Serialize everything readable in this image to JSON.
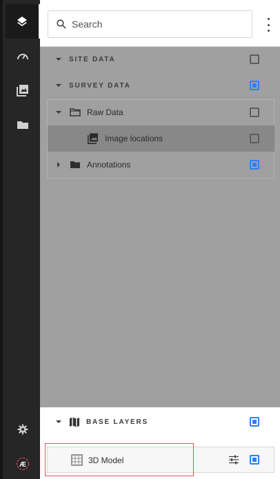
{
  "rail": {
    "items": [
      {
        "icon": "layers-icon",
        "active": true
      },
      {
        "icon": "gauge-icon",
        "active": false
      },
      {
        "icon": "image-gallery-icon",
        "active": false
      },
      {
        "icon": "folder-icon",
        "active": false
      }
    ],
    "bottom_items": [
      {
        "icon": "gear-icon"
      },
      {
        "icon": "logo-icon",
        "logo_text": "Æ"
      }
    ]
  },
  "search": {
    "placeholder": "Search",
    "value": ""
  },
  "layers": {
    "site_data": {
      "label": "SITE DATA",
      "checked": false
    },
    "survey_data": {
      "label": "SURVEY DATA",
      "checked": "partial"
    },
    "raw_data": {
      "label": "Raw Data",
      "checked": false
    },
    "image_locations": {
      "label": "Image locations",
      "checked": false
    },
    "annotations": {
      "label": "Annotations",
      "checked": true
    }
  },
  "base_layers": {
    "label": "BASE LAYERS",
    "checked": "partial",
    "model": {
      "label": "3D Model",
      "checked": true
    }
  },
  "colors": {
    "accent": "#2f80ed",
    "highlight": "#e0524f"
  }
}
